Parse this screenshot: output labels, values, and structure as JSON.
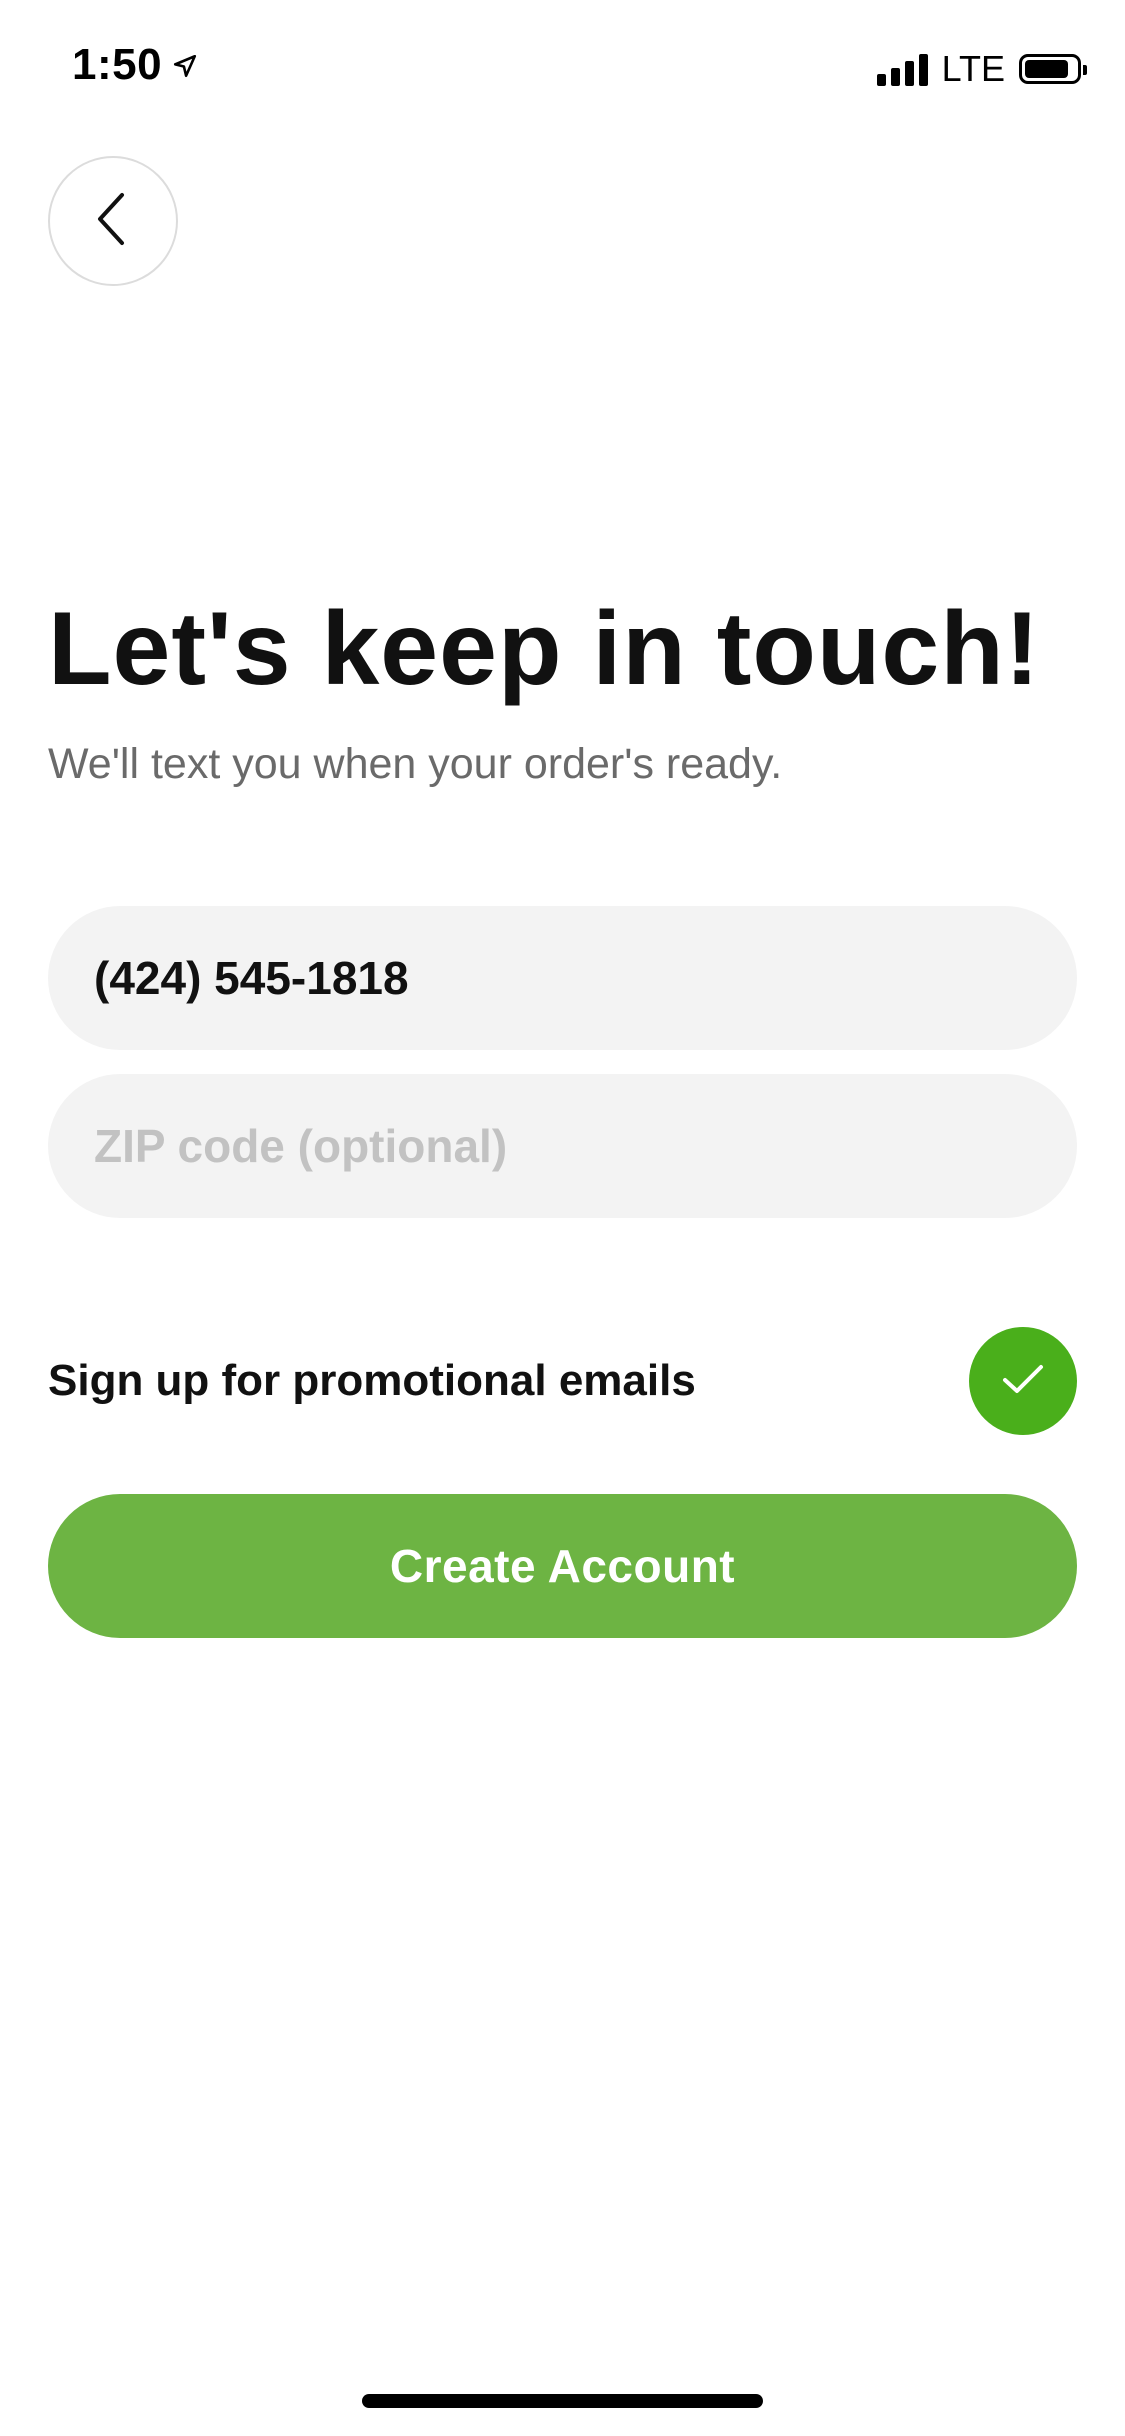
{
  "status_bar": {
    "time": "1:50",
    "network": "LTE",
    "battery_level": 0.85,
    "signal_bars": 4,
    "icons": [
      "location-arrow-icon",
      "signal-icon",
      "battery-icon"
    ]
  },
  "nav": {
    "back_icon": "chevron-left-icon"
  },
  "header": {
    "title": "Let's keep in touch!",
    "subtitle": "We'll text you when your order's ready."
  },
  "form": {
    "phone_value": "(424) 545-1818",
    "zip_placeholder": "ZIP code (optional)",
    "zip_value": "",
    "promo_label": "Sign up for promotional emails",
    "promo_checked": true,
    "promo_icon": "checkmark-icon",
    "submit_label": "Create Account"
  },
  "colors": {
    "accent_green": "#6db443",
    "check_green": "#4aaf1b",
    "input_bg": "#f3f3f3",
    "subtitle_gray": "#6a6a6a",
    "placeholder_gray": "#c2c2c2"
  }
}
